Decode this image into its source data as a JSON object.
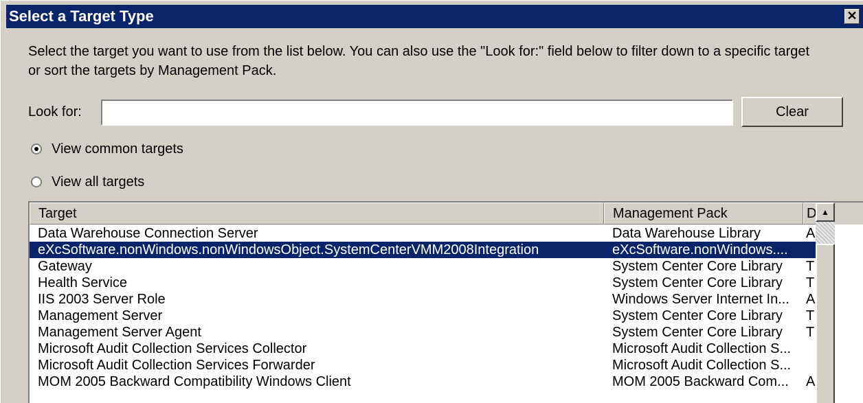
{
  "window": {
    "title": "Select a Target Type",
    "close_glyph": "✕"
  },
  "description": "Select the target you want to use from the list below. You can also use the \"Look for:\" field below to filter down to a specific target or sort the targets by Management Pack.",
  "search": {
    "label": "Look for:",
    "value": "",
    "placeholder": "",
    "clear_label": "Clear"
  },
  "options": {
    "common": {
      "label": "View common targets",
      "checked": true
    },
    "all": {
      "label": "View all targets",
      "checked": false
    }
  },
  "table": {
    "headers": [
      "Target",
      "Management Pack",
      "D"
    ],
    "rows": [
      {
        "target": "Data Warehouse Connection Server",
        "pack": "Data Warehouse Library",
        "extra": "A"
      },
      {
        "target": "eXcSoftware.nonWindows.nonWindowsObject.SystemCenterVMM2008Integration",
        "pack": "eXcSoftware.nonWindows....",
        "extra": "",
        "selected": true
      },
      {
        "target": "Gateway",
        "pack": "System Center Core Library",
        "extra": "T"
      },
      {
        "target": "Health Service",
        "pack": "System Center Core Library",
        "extra": "T"
      },
      {
        "target": "IIS 2003 Server Role",
        "pack": "Windows Server Internet In...",
        "extra": "A"
      },
      {
        "target": "Management Server",
        "pack": "System Center Core Library",
        "extra": "T"
      },
      {
        "target": "Management Server Agent",
        "pack": "System Center Core Library",
        "extra": "T"
      },
      {
        "target": "Microsoft Audit Collection Services Collector",
        "pack": "Microsoft Audit Collection S...",
        "extra": ""
      },
      {
        "target": "Microsoft Audit Collection Services Forwarder",
        "pack": "Microsoft Audit Collection S...",
        "extra": ""
      },
      {
        "target": "MOM 2005 Backward Compatibility Windows Client",
        "pack": "MOM 2005 Backward Com...",
        "extra": "A"
      }
    ]
  },
  "colors": {
    "titlebar": "#0a246a",
    "selection": "#0a246a",
    "face": "#d4d0c8"
  }
}
